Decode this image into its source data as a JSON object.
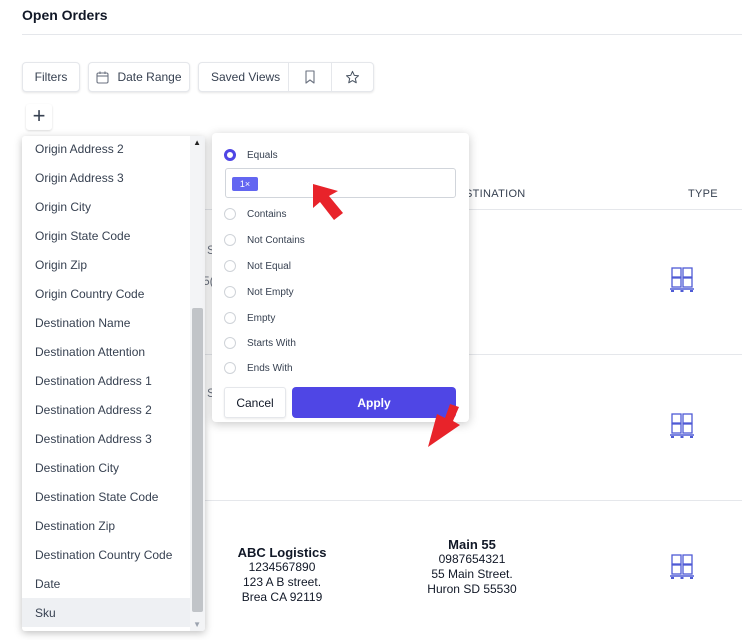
{
  "page": {
    "title": "Open Orders"
  },
  "toolbar": {
    "filters_label": "Filters",
    "date_range_label": "Date Range",
    "saved_views_label": "Saved Views",
    "add_label": "+"
  },
  "table": {
    "headers": {
      "destination": "STINATION",
      "type": "TYPE"
    },
    "rows": [
      {
        "clip_a": "S",
        "clip_b": "5("
      },
      {
        "clip_a": "S"
      },
      {
        "origin": {
          "name": "ABC Logistics",
          "phone": "1234567890",
          "street": "123 A B street.",
          "city": "Brea CA 92119"
        },
        "destination": {
          "name": "Main 55",
          "phone": "0987654321",
          "street": "55 Main Street.",
          "city": "Huron SD 55530"
        }
      }
    ]
  },
  "field_list": {
    "items": [
      "Origin Address 2",
      "Origin Address 3",
      "Origin City",
      "Origin State Code",
      "Origin Zip",
      "Origin Country Code",
      "Destination Name",
      "Destination Attention",
      "Destination Address 1",
      "Destination Address 2",
      "Destination Address 3",
      "Destination City",
      "Destination State Code",
      "Destination Zip",
      "Destination Country Code",
      "Date",
      "Sku"
    ],
    "selected": "Sku"
  },
  "condition": {
    "options": [
      "Equals",
      "Contains",
      "Not Contains",
      "Not Equal",
      "Not Empty",
      "Empty",
      "Starts With",
      "Ends With"
    ],
    "selected": "Equals",
    "chip_label": "1×",
    "cancel_label": "Cancel",
    "apply_label": "Apply"
  },
  "colors": {
    "accent": "#4f46e5",
    "chip": "#6366f1",
    "annotation_arrow": "#e8232a"
  }
}
